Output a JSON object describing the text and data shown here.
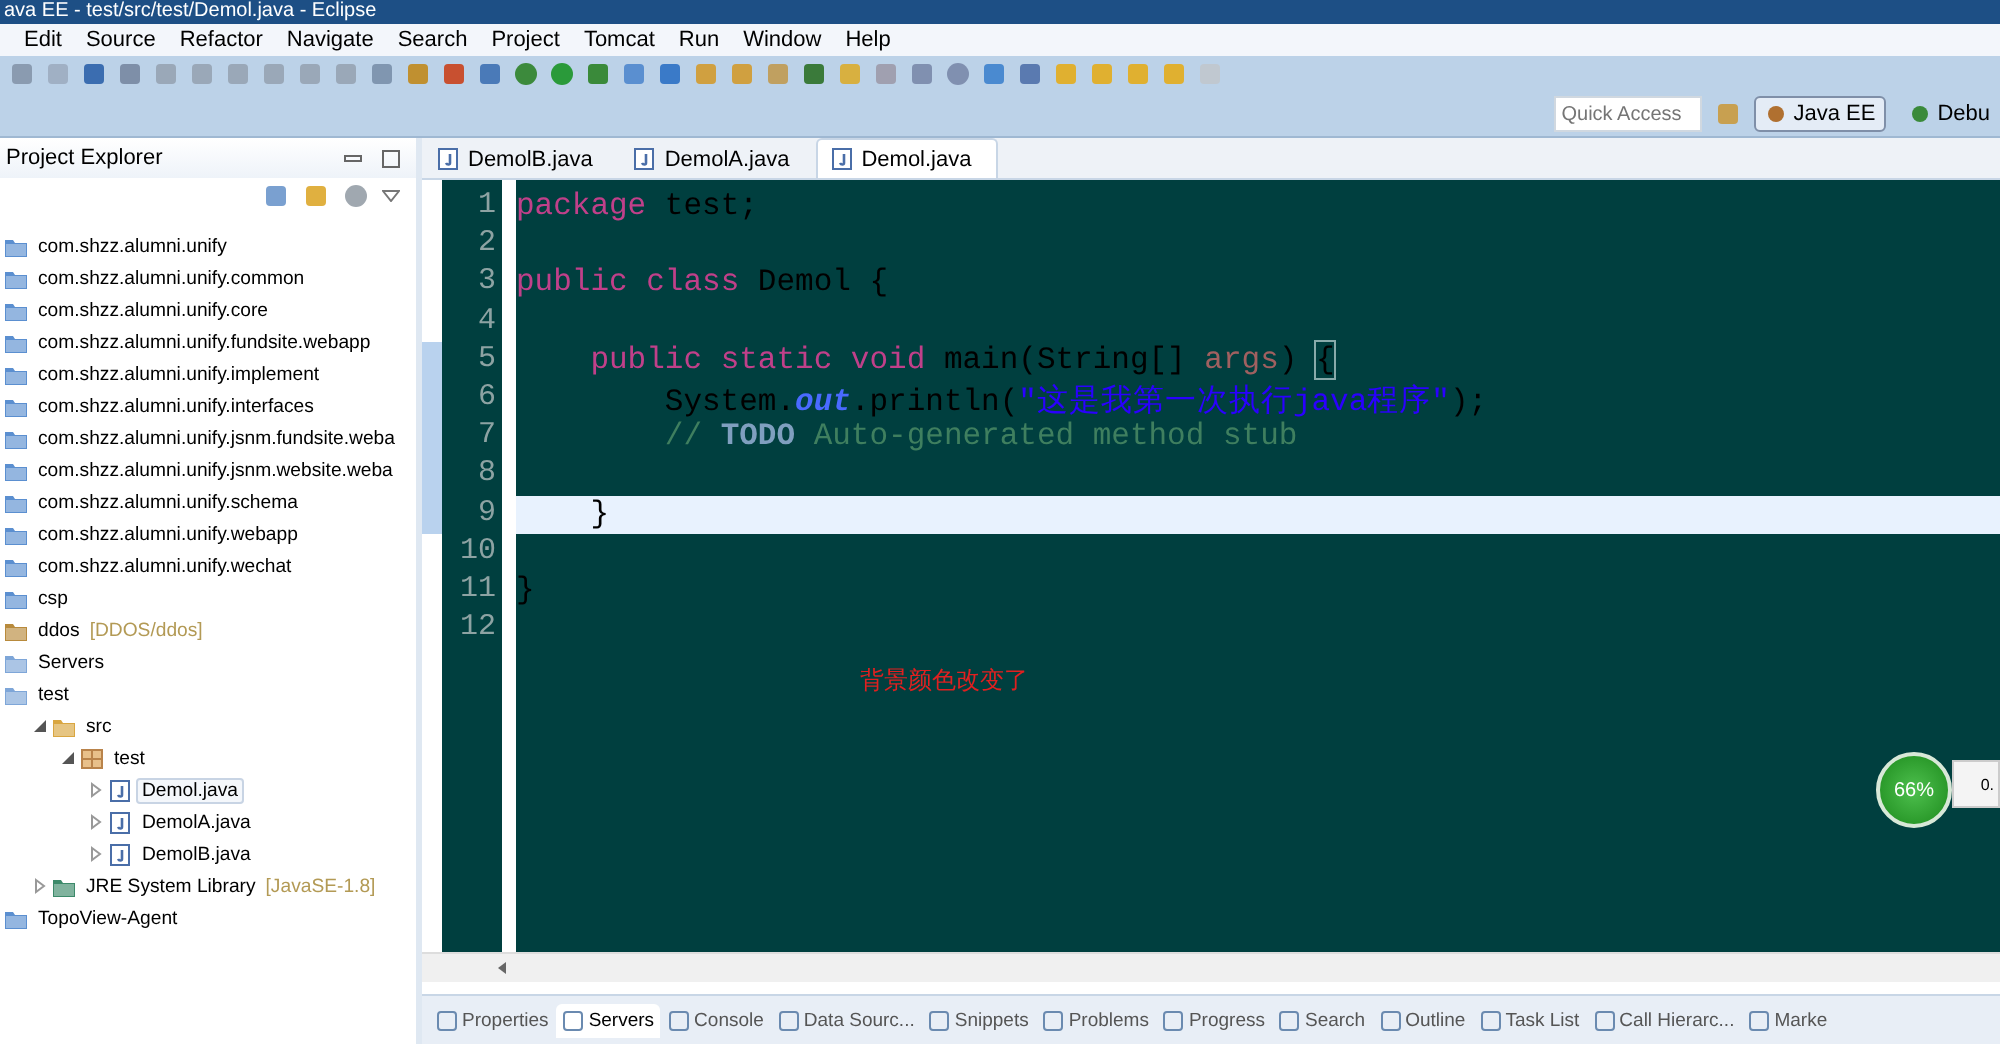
{
  "window": {
    "title": "ava EE - test/src/test/Demol.java - Eclipse"
  },
  "menu": [
    "Edit",
    "Source",
    "Refactor",
    "Navigate",
    "Search",
    "Project",
    "Tomcat",
    "Run",
    "Window",
    "Help"
  ],
  "quick_access": {
    "placeholder": "Quick Access"
  },
  "perspectives": [
    {
      "label": "Java EE",
      "selected": true
    },
    {
      "label": "Debu",
      "selected": false
    }
  ],
  "project_explorer": {
    "title": "Project Explorer",
    "items": [
      {
        "label": "com.shzz.alumni.unify",
        "kind": "project",
        "selected": false
      },
      {
        "label": "com.shzz.alumni.unify.common",
        "kind": "project",
        "selected": false
      },
      {
        "label": "com.shzz.alumni.unify.core",
        "kind": "project",
        "selected": false
      },
      {
        "label": "com.shzz.alumni.unify.fundsite.webapp",
        "kind": "project",
        "selected": false
      },
      {
        "label": "com.shzz.alumni.unify.implement",
        "kind": "project",
        "selected": false
      },
      {
        "label": "com.shzz.alumni.unify.interfaces",
        "kind": "project",
        "selected": false
      },
      {
        "label": "com.shzz.alumni.unify.jsnm.fundsite.weba",
        "kind": "project",
        "selected": false
      },
      {
        "label": "com.shzz.alumni.unify.jsnm.website.weba",
        "kind": "project",
        "selected": false
      },
      {
        "label": "com.shzz.alumni.unify.schema",
        "kind": "project",
        "selected": false
      },
      {
        "label": "com.shzz.alumni.unify.webapp",
        "kind": "project",
        "selected": false
      },
      {
        "label": "com.shzz.alumni.unify.wechat",
        "kind": "project",
        "selected": false
      },
      {
        "label": "csp",
        "kind": "project",
        "selected": false
      },
      {
        "label": "ddos",
        "decoration": "[DDOS/ddos]",
        "kind": "repo",
        "selected": false
      },
      {
        "label": "Servers",
        "kind": "open-project",
        "selected": false
      },
      {
        "label": "test",
        "kind": "open-project",
        "selected": false,
        "children": [
          {
            "label": "src",
            "kind": "source",
            "expanded": true,
            "selected": false,
            "children": [
              {
                "label": "test",
                "kind": "package",
                "expanded": true,
                "selected": false,
                "children": [
                  {
                    "label": "Demol.java",
                    "kind": "java",
                    "expanded": false,
                    "selected": true
                  },
                  {
                    "label": "DemolA.java",
                    "kind": "java",
                    "expanded": false,
                    "selected": false
                  },
                  {
                    "label": "DemolB.java",
                    "kind": "java",
                    "expanded": false,
                    "selected": false
                  }
                ]
              }
            ]
          },
          {
            "label": "JRE System Library",
            "decoration": "[JavaSE-1.8]",
            "kind": "library",
            "expanded": false,
            "selected": false
          }
        ]
      },
      {
        "label": "TopoView-Agent",
        "kind": "project",
        "selected": false
      }
    ]
  },
  "editor": {
    "tabs": [
      {
        "label": "DemolB.java",
        "selected": false
      },
      {
        "label": "DemolA.java",
        "selected": false
      },
      {
        "label": "Demol.java",
        "selected": true
      }
    ],
    "lines": [
      {
        "number": "1",
        "kind": "top",
        "current": false,
        "tokens": [
          {
            "kind": "keyword",
            "text": "package"
          },
          {
            "kind": "plain",
            "text": " test;"
          }
        ]
      },
      {
        "number": "2",
        "kind": "top"
      },
      {
        "number": "3",
        "kind": "top",
        "current": false,
        "tokens": [
          {
            "kind": "keyword",
            "text": "public class"
          },
          {
            "kind": "plain",
            "text": " Demol {"
          }
        ]
      },
      {
        "number": "4",
        "kind": "top"
      },
      {
        "number": "5",
        "kind": "member",
        "current": false,
        "tokens": [
          {
            "kind": "keyword",
            "text": "public static void"
          },
          {
            "kind": "plain",
            "text": " main(String[] "
          },
          {
            "kind": "param",
            "text": "args"
          },
          {
            "kind": "plain",
            "text": ") "
          },
          {
            "kind": "bracket",
            "text": "{"
          }
        ]
      },
      {
        "number": "6",
        "kind": "body",
        "current": false,
        "tokens": [
          {
            "kind": "plain",
            "text": "System."
          },
          {
            "kind": "field",
            "text": "out"
          },
          {
            "kind": "plain",
            "text": ".println("
          },
          {
            "kind": "string",
            "text": "\"这是我第一次执行java程序\""
          },
          {
            "kind": "plain",
            "text": ");"
          }
        ]
      },
      {
        "number": "7",
        "kind": "body",
        "current": false,
        "tokens": [
          {
            "kind": "comment",
            "text": "// "
          },
          {
            "kind": "todo",
            "text": "TODO"
          },
          {
            "kind": "comment",
            "text": " Auto-generated method stub"
          }
        ]
      },
      {
        "number": "8",
        "kind": "top"
      },
      {
        "number": "9",
        "kind": "member",
        "current": true,
        "tokens": [
          {
            "kind": "plain",
            "text": "}"
          }
        ]
      },
      {
        "number": "10",
        "kind": "top"
      },
      {
        "number": "11",
        "kind": "top",
        "current": false,
        "tokens": [
          {
            "kind": "plain",
            "text": "}"
          }
        ]
      },
      {
        "number": "12",
        "kind": "top"
      }
    ],
    "note": "背景颜色改变了"
  },
  "speed_widget": {
    "percent": "66%",
    "reading": "0."
  },
  "bottom_tabs": [
    {
      "label": "Properties",
      "selected": false
    },
    {
      "label": "Servers",
      "selected": true
    },
    {
      "label": "Console",
      "selected": false
    },
    {
      "label": "Data Sourc...",
      "selected": false
    },
    {
      "label": "Snippets",
      "selected": false
    },
    {
      "label": "Problems",
      "selected": false
    },
    {
      "label": "Progress",
      "selected": false
    },
    {
      "label": "Search",
      "selected": false
    },
    {
      "label": "Outline",
      "selected": false
    },
    {
      "label": "Task List",
      "selected": false
    },
    {
      "label": "Call Hierarc...",
      "selected": false
    },
    {
      "label": "Marke",
      "selected": false
    }
  ]
}
